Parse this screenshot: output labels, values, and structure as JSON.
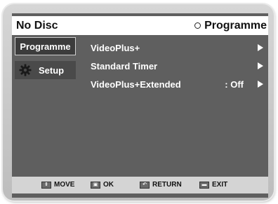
{
  "header": {
    "title": "No Disc",
    "right_label": "Programme",
    "right_icon": "circle-icon"
  },
  "sidebar": {
    "items": [
      {
        "label": "Programme",
        "icon": null,
        "selected": true
      },
      {
        "label": "Setup",
        "icon": "gear-icon",
        "selected": false
      }
    ]
  },
  "menu": {
    "items": [
      {
        "label": "VideoPlus+",
        "value": "",
        "arrow": "right-arrow-icon"
      },
      {
        "label": "Standard Timer",
        "value": "",
        "arrow": "right-arrow-icon"
      },
      {
        "label": "VideoPlus+Extended",
        "value": ": Off",
        "arrow": "right-arrow-icon"
      }
    ]
  },
  "footer": {
    "items": [
      {
        "label": "MOVE",
        "icon": "updown-icon"
      },
      {
        "label": "OK",
        "icon": "ok-icon"
      },
      {
        "label": "RETURN",
        "icon": "return-icon"
      },
      {
        "label": "EXIT",
        "icon": "exit-icon"
      }
    ]
  },
  "colors": {
    "screen_bg": "#5f5f5f",
    "title_bg": "#ffffff",
    "frame": "#c8c8c8",
    "footer_bg": "#d4d4d4",
    "text_light": "#ffffff",
    "text_dark": "#111111"
  }
}
